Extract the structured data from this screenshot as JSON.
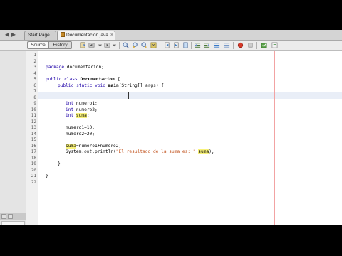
{
  "tabs": [
    {
      "label": "Start Page",
      "active": false
    },
    {
      "label": "Documentacion.java",
      "active": true
    }
  ],
  "tab_close_glyph": "×",
  "toolbar": {
    "source_label": "Source",
    "history_label": "History"
  },
  "editor": {
    "line_numbers": [
      "1",
      "2",
      "3",
      "4",
      "5",
      "6",
      "7",
      "8",
      "9",
      "10",
      "11",
      "12",
      "13",
      "14",
      "15",
      "16",
      "17",
      "18",
      "19",
      "20",
      "21",
      "22"
    ],
    "current_line": 8
  },
  "code": {
    "l3_kw": "package",
    "l3_rest": " documentacion;",
    "l5_kw1": "public",
    "l5_kw2": " class ",
    "l5_name": "Documentacion",
    "l5_rest": " {",
    "l6_kw1": "public",
    "l6_kw2": " static void ",
    "l6_name": "main",
    "l6_rest": "(String[] args) {",
    "l9_kw": "int",
    "l9_rest": " numero1;",
    "l10_kw": "int",
    "l10_rest": " numero2;",
    "l11_kw": "int",
    "l11_var": "suma",
    "l11_rest": ";",
    "l13": "numero1=10;",
    "l14": "numero2=20;",
    "l16_var": "suma",
    "l16_rest": "=numero1+numero2;",
    "l17_a": "System.",
    "l17_out": "out",
    "l17_b": ".println(",
    "l17_str": "\"El resultado de la suma es: \"",
    "l17_c": "+",
    "l17_var": "suma",
    "l17_d": ");",
    "l19": "}",
    "l21": "}"
  }
}
